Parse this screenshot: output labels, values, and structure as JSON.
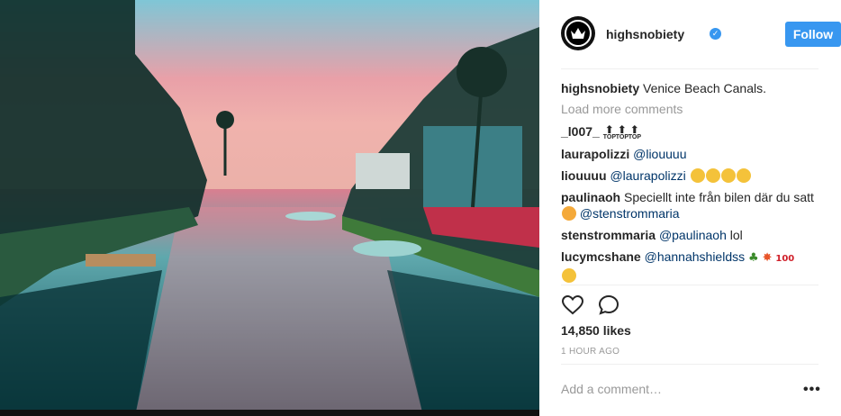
{
  "post": {
    "username": "highsnobiety",
    "follow_label": "Follow",
    "caption_user": "highsnobiety",
    "caption_text": "Venice Beach Canals.",
    "load_more": "Load more comments",
    "comments": [
      {
        "user": "_l007_",
        "text": "",
        "mention": "",
        "extra": "top-arrows"
      },
      {
        "user": "laurapolizzi",
        "text": "",
        "mention": "@liouuuu",
        "extra": ""
      },
      {
        "user": "liouuuu",
        "text": "",
        "mention": "@laurapolizzi",
        "extra": "smileys"
      },
      {
        "user": "paulinaoh",
        "text": "Speciellt inte från bilen där du satt",
        "mention": "@stenstrommaria",
        "extra": ""
      },
      {
        "user": "stenstrommaria",
        "text": "",
        "mention": "@paulinaoh",
        "suffix": "lol"
      },
      {
        "user": "lucymcshane",
        "text": "",
        "mention": "@hannahshieldss",
        "extra": "emojis"
      }
    ],
    "top_label": "TOP",
    "likes": "14,850 likes",
    "time": "1 HOUR AGO",
    "add_comment_placeholder": "Add a comment…",
    "more_label": "•••",
    "icons": [
      "heart-icon",
      "comment-icon",
      "verified-icon",
      "more-options-icon"
    ],
    "colors": {
      "accent": "#3897f0",
      "mention": "#003569",
      "muted": "#999999"
    }
  }
}
